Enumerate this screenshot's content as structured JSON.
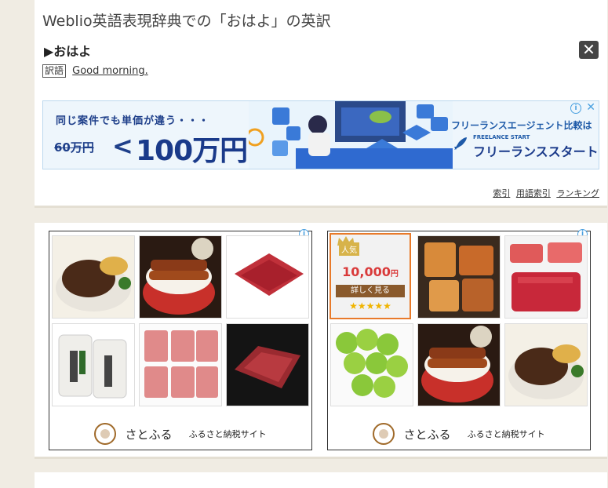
{
  "header": {
    "title": "Weblio英語表現辞典での「おはよ」の英訳",
    "close_glyph": "✕"
  },
  "entry": {
    "headword": "▶おはよ",
    "tag": "訳語",
    "translation": "Good morning."
  },
  "ad_banner": {
    "info_glyph": "i",
    "close_glyph": "✕",
    "tagline": "同じ案件でも単価が違う・・・",
    "old_price": "60万円",
    "compare_symbol": "<",
    "new_price": "100万円",
    "compare_text": "フリーランスエージェント比較は",
    "brand_sub": "FREELANCE START",
    "brand": "フリーランススタート"
  },
  "footer_links": [
    {
      "label": "索引"
    },
    {
      "label": "用語索引"
    },
    {
      "label": "ランキング"
    }
  ],
  "ad_panels": [
    {
      "brand": "さとふる",
      "sub": "ふるさと納税サイト",
      "info_glyph": "i",
      "tiles": [
        "hamburg-steak",
        "unagi-don",
        "sliced-beef",
        "rice-bags",
        "sliced-pork",
        "beef-block"
      ]
    },
    {
      "brand": "さとふる",
      "sub": "ふるさと納税サイト",
      "info_glyph": "i",
      "promo": {
        "ribbon": "人気",
        "price": "10,000",
        "price_unit": "円",
        "button": "詳しく見る",
        "stars": "★★★★★"
      },
      "tiles": [
        "promo",
        "gift-set",
        "tuna",
        "grapes",
        "unagi-don",
        "hamburg-steak"
      ]
    }
  ],
  "colors": {
    "page_bg": "#f0ece3",
    "brand_blue": "#1a3a8a",
    "promo_price": "#d93a3a",
    "promo_border": "#e87a2a"
  }
}
